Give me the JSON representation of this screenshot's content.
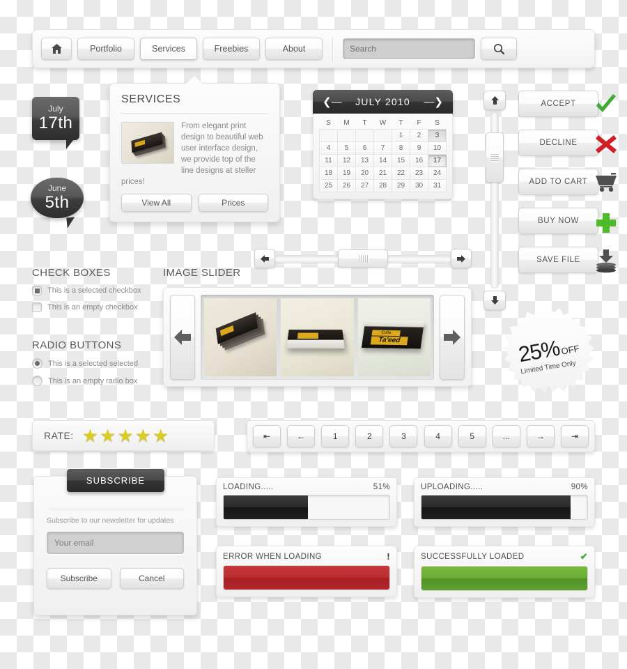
{
  "navbar": {
    "home_icon": "home-icon",
    "items": [
      {
        "label": "Portfolio",
        "active": false
      },
      {
        "label": "Services",
        "active": true
      },
      {
        "label": "Freebies",
        "active": false
      },
      {
        "label": "About",
        "active": false
      }
    ],
    "search": {
      "value": "",
      "placeholder": "Search",
      "icon": "search-icon"
    }
  },
  "date_badges": [
    {
      "month": "July",
      "day": "17th"
    },
    {
      "month": "June",
      "day": "5th"
    }
  ],
  "services_panel": {
    "title": "SERVICES",
    "body": "From elegant print design to beautiful web user interface design, we provide top of the line designs at steller prices!",
    "view_all_label": "View All",
    "prices_label": "Prices"
  },
  "calendar": {
    "title": "JULY 2010",
    "prev_icon": "arrow-left-icon",
    "next_icon": "arrow-right-icon",
    "weekdays": [
      "S",
      "M",
      "T",
      "W",
      "T",
      "F",
      "S"
    ],
    "weeks": [
      [
        "",
        "",
        "",
        "",
        "1",
        "2",
        "3"
      ],
      [
        "4",
        "5",
        "6",
        "7",
        "8",
        "9",
        "10"
      ],
      [
        "11",
        "12",
        "13",
        "14",
        "15",
        "16",
        "17"
      ],
      [
        "18",
        "19",
        "20",
        "21",
        "22",
        "23",
        "24"
      ],
      [
        "25",
        "26",
        "27",
        "28",
        "29",
        "30",
        "31"
      ]
    ],
    "highlighted": "3",
    "selected": "17"
  },
  "scrollbars": {
    "vertical": {
      "up_icon": "arrow-up-icon",
      "down_icon": "arrow-down-icon",
      "thumb": "scroll-thumb"
    },
    "horizontal": {
      "left_icon": "arrow-left-icon",
      "right_icon": "arrow-right-icon",
      "thumb": "scroll-thumb"
    }
  },
  "action_buttons": [
    {
      "label": "ACCEPT",
      "icon": "check-icon",
      "color": "#3faa35"
    },
    {
      "label": "DECLINE",
      "icon": "cross-icon",
      "color": "#cf2027"
    },
    {
      "label": "ADD TO CART",
      "icon": "cart-icon",
      "color": "#4f4f4f"
    },
    {
      "label": "BUY NOW",
      "icon": "plus-icon",
      "color": "#4fba2a"
    },
    {
      "label": "SAVE FILE",
      "icon": "save-download-icon",
      "color": "#4f4f4f"
    }
  ],
  "check_boxes": {
    "title": "CHECK BOXES",
    "options": [
      {
        "label": "This is a selected checkbox",
        "checked": true
      },
      {
        "label": "This is an empty checkbox",
        "checked": false
      }
    ]
  },
  "radio_buttons": {
    "title": "RADIO BUTTONS",
    "options": [
      {
        "label": "This is a selected selected",
        "checked": true
      },
      {
        "label": "This is an empty radio box",
        "checked": false
      }
    ]
  },
  "image_slider": {
    "title": "IMAGE SLIDER",
    "prev_icon": "arrow-left-icon",
    "next_icon": "arrow-right-icon",
    "slides": [
      {
        "name": "business-card-fan-photo"
      },
      {
        "name": "business-card-stack-photo"
      },
      {
        "name": "business-card-box-photo",
        "brand_top": "Colla",
        "brand_main": "Ta'eed"
      }
    ]
  },
  "discount_badge": {
    "percent": "25%",
    "off": "OFF",
    "subtitle": "Limited Time Only"
  },
  "rate": {
    "label": "RATE:",
    "stars_filled": 5,
    "star_glyph": "★"
  },
  "pagination": {
    "buttons": [
      {
        "label": "⇤",
        "name": "first-page-button"
      },
      {
        "label": "←",
        "name": "prev-page-button"
      },
      {
        "label": "1",
        "name": "page-1-button"
      },
      {
        "label": "2",
        "name": "page-2-button"
      },
      {
        "label": "3",
        "name": "page-3-button"
      },
      {
        "label": "4",
        "name": "page-4-button"
      },
      {
        "label": "5",
        "name": "page-5-button"
      },
      {
        "label": "...",
        "name": "page-ellipsis-button"
      },
      {
        "label": "→",
        "name": "next-page-button"
      },
      {
        "label": "⇥",
        "name": "last-page-button"
      }
    ]
  },
  "subscribe": {
    "tab_label": "SUBSCRIBE",
    "description": "Subscribe to our newsletter for updates",
    "email_value": "",
    "email_placeholder": "Your email",
    "submit_label": "Subscribe",
    "cancel_label": "Cancel"
  },
  "progress": {
    "loading": {
      "label": "LOADING.....",
      "percent": "51%",
      "value": 51
    },
    "uploading": {
      "label": "UPLOADING.....",
      "percent": "90%",
      "value": 90
    }
  },
  "status": {
    "error": {
      "label": "ERROR WHEN LOADING",
      "mark": "!",
      "color": "#b4262c"
    },
    "success": {
      "label": "SUCCESSFULLY LOADED",
      "mark": "✔",
      "color": "#4e9c2a"
    }
  }
}
